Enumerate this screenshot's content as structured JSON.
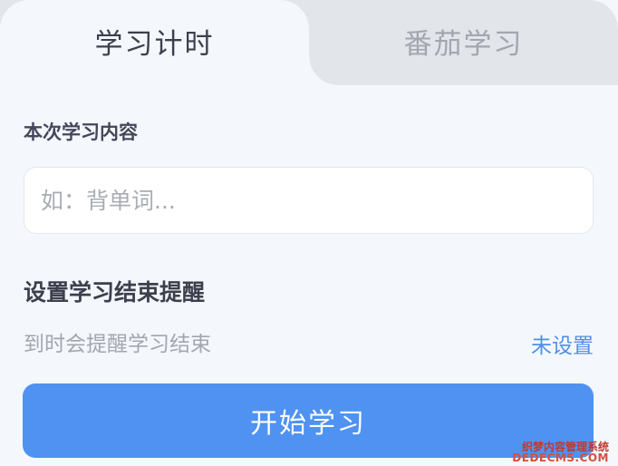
{
  "tabs": [
    {
      "label": "学习计时",
      "active": true
    },
    {
      "label": "番茄学习",
      "active": false
    }
  ],
  "content": {
    "label": "本次学习内容",
    "placeholder": "如：背单词..."
  },
  "reminder": {
    "title": "设置学习结束提醒",
    "description": "到时会提醒学习结束",
    "status": "未设置"
  },
  "start_button": {
    "label": "开始学习"
  },
  "watermark": {
    "line1": "织梦内容管理系统",
    "line2": "DEDECMS.COM"
  },
  "colors": {
    "primary": "#4f92f2",
    "link": "#4e8fe8",
    "background": "#f4f7fc",
    "tab_inactive": "#e2e5ea"
  }
}
